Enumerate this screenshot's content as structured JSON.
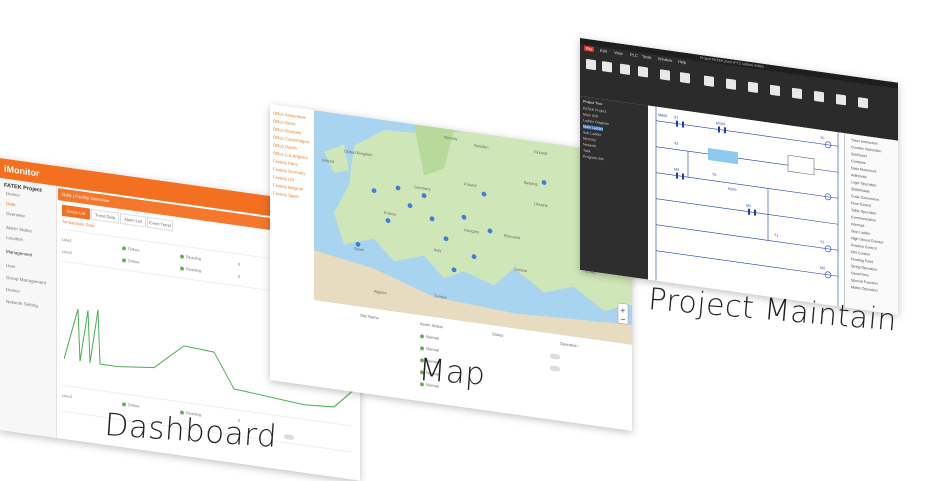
{
  "captions": {
    "dashboard": "Dashboard",
    "map": "Map",
    "project_maintain": "Project Maintain"
  },
  "colors": {
    "accent_orange": "#f37021",
    "ladder_blue": "#1a3fa8",
    "status_green": "#6ab04c",
    "ribbon_dark": "#2b2b2b"
  },
  "dashboard": {
    "app_title": "iMonitor",
    "project": "FATEK Project",
    "sidebar": [
      "Device",
      "Data",
      "Overview",
      "Alarm Status",
      "Location",
      "Management",
      "User",
      "Group Management",
      "Device",
      "Network Setting"
    ],
    "breadcrumb": "Data  |  Facility Overview",
    "tabs": [
      "Status List",
      "Trend Data",
      "Alarm List",
      "Event Trend"
    ],
    "section": "Temperature Data",
    "rows": [
      {
        "name": "Line1",
        "status": "Online",
        "type": "Reading",
        "val": "0"
      },
      {
        "name": "Line2",
        "status": "Online",
        "type": "Reading",
        "val": "0"
      },
      {
        "name": "Line3",
        "status": "Online",
        "type": "Reading",
        "val": "0"
      }
    ],
    "icons": [
      "menu-icon",
      "user-icon",
      "location-icon"
    ]
  },
  "map": {
    "locations": [
      "Office Amsterdam",
      "Office Berlin",
      "Office Brussels",
      "Office Copenhagen",
      "Office Dublin",
      "Office Los Angeles",
      "Factory Paris",
      "Factory Germany",
      "Factory US",
      "Factory Belgium",
      "Factory Spain"
    ],
    "country_labels": [
      "Ireland",
      "United Kingdom",
      "Germany",
      "Poland",
      "France",
      "Spain",
      "Italy",
      "Ukraine",
      "Romania",
      "Hungary",
      "Norway",
      "Sweden",
      "Finland",
      "Belarus",
      "Turkey",
      "Greece",
      "Algeria",
      "Tunisia"
    ],
    "table_header": [
      "Site Name",
      "Alarm Status",
      "Status",
      "Operation"
    ],
    "rows": [
      "Normal",
      "Normal",
      "Normal",
      "Normal",
      "Normal"
    ]
  },
  "project_maintain": {
    "window_title": "Project FATEK.plant (PLC ladder) Editor",
    "tabs": [
      "File",
      "Edit",
      "View",
      "PLC",
      "Tools",
      "Window",
      "Help"
    ],
    "tree": [
      "Project Tree",
      "  FATEK Project",
      "    Main Unit",
      "      Ladder Diagram",
      "        Main Ladder",
      "        Sub Ladder",
      "      Memory",
      "    Network",
      "  Task",
      "    Program Info"
    ],
    "ladder_labels": [
      "M800",
      "X1",
      "M100",
      "X2",
      "Y0",
      "M0",
      "T0",
      "K200",
      "M1",
      "T1",
      "Y1",
      "M2"
    ],
    "instructions": [
      "Timer Instruction",
      "Counter Instruction",
      "Set/Reset",
      "Compare",
      "Data Movement",
      "Arithmetic",
      "Logic Operation",
      "Shift/Rotate",
      "Code Conversion",
      "Flow Control",
      "Table Operation",
      "Communication",
      "Interrupt",
      "Step Ladder",
      "High Speed Counter",
      "Position Control",
      "PID Control",
      "Floating Point",
      "String Operation",
      "Clock/Time",
      "Special Function",
      "Matrix Operation"
    ]
  }
}
